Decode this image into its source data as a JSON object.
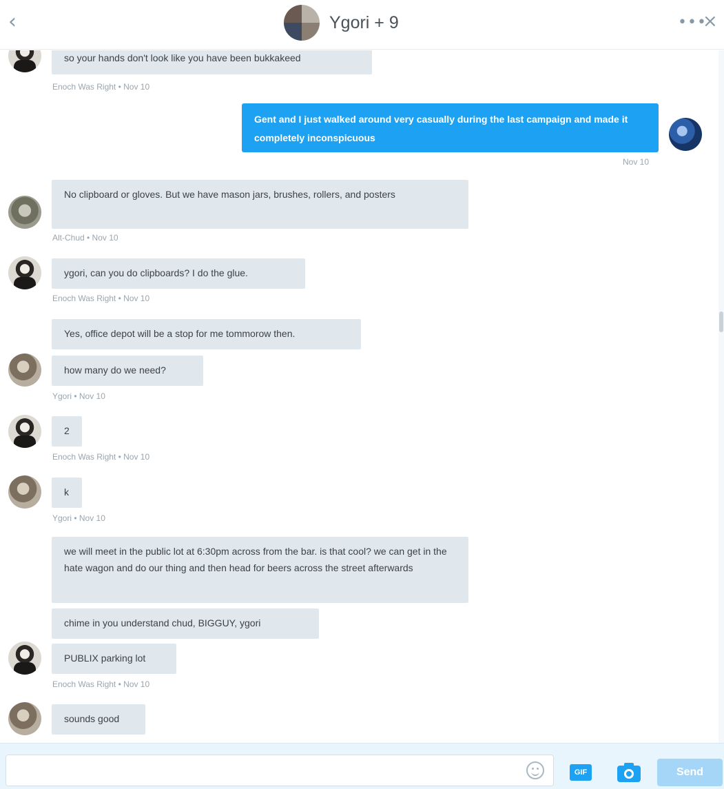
{
  "header": {
    "back_icon": "chevron-left-icon",
    "title": "Ygori + 9",
    "more_icon": "ellipsis-icon",
    "close_icon": "close-icon"
  },
  "messages": [
    {
      "direction": "in",
      "text": "so your hands don't look like you have been bukkakeed"
    },
    {
      "direction": "meta",
      "text": "Enoch Was Right • Nov 10"
    },
    {
      "direction": "out",
      "text": "Gent and I just walked around very casually during the last campaign and made it completely inconspicuous"
    },
    {
      "direction": "meta",
      "text": "Nov 10"
    },
    {
      "direction": "in",
      "text": "No clipboard or gloves. But we have mason jars, brushes, rollers, and posters"
    },
    {
      "direction": "meta",
      "text": "Alt-Chud • Nov 10"
    },
    {
      "direction": "in",
      "text": "ygori, can you do clipboards? I do the glue."
    },
    {
      "direction": "meta",
      "text": "Enoch Was Right • Nov 10"
    },
    {
      "direction": "in",
      "text": "Yes, office depot will be a stop for me tommorow then."
    },
    {
      "direction": "in",
      "text": "how many do we need?"
    },
    {
      "direction": "meta",
      "text": "Ygori • Nov 10"
    },
    {
      "direction": "in",
      "text": "2"
    },
    {
      "direction": "meta",
      "text": "Enoch Was Right • Nov 10"
    },
    {
      "direction": "in",
      "text": "k"
    },
    {
      "direction": "meta",
      "text": "Ygori • Nov 10"
    },
    {
      "direction": "in",
      "text": "we will meet in the public lot at 6:30pm across from the bar. is that cool? we can get in the hate wagon and do our thing and then head for beers across the street afterwards"
    },
    {
      "direction": "in",
      "text": "chime in you understand chud, BIGGUY, ygori"
    },
    {
      "direction": "in",
      "text": "PUBLIX parking lot"
    },
    {
      "direction": "meta",
      "text": "Enoch Was Right • Nov 10"
    },
    {
      "direction": "in",
      "text": "sounds good"
    }
  ],
  "composer": {
    "input_value": "",
    "emoji_icon": "emoji-icon",
    "gif_label": "GIF",
    "camera_icon": "camera-icon",
    "send_label": "Send"
  },
  "colors": {
    "accent": "#1da1f2",
    "bubble_in": "#e1e8ed",
    "meta_text": "#99a5ae",
    "composer_bg": "#e8f5fd"
  }
}
